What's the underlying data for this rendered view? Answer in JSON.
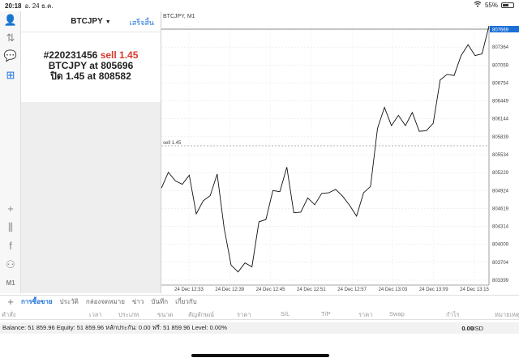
{
  "status": {
    "time": "20:18",
    "date": "อ. 24 ธ.ค.",
    "battery": "55%",
    "battery_level": 0.55
  },
  "toolbar": {
    "top": [
      {
        "name": "account-icon",
        "glyph": "👤"
      },
      {
        "name": "trade-icon",
        "glyph": "⇅"
      },
      {
        "name": "chat-icon",
        "glyph": "💬"
      },
      {
        "name": "new-order-icon",
        "glyph": "⊞"
      }
    ],
    "bottom": [
      {
        "name": "crosshair-icon",
        "glyph": "+"
      },
      {
        "name": "chart-type-icon",
        "glyph": "⫼"
      },
      {
        "name": "indicator-icon",
        "glyph": "f"
      },
      {
        "name": "objects-icon",
        "glyph": "⚇"
      },
      {
        "name": "timeframe-icon",
        "glyph": "M1"
      }
    ]
  },
  "order_panel": {
    "symbol": "BTCJPY",
    "caret": "▼",
    "done_label": "เสร็จสิ้น",
    "ticket": "#220231456",
    "side": "sell 1.45",
    "line2": "BTCJPY at 805696",
    "line3_prefix": "ปิด 1.45 at",
    "close_price": "808582"
  },
  "chart_data": {
    "type": "line",
    "title": "BTCJPY, M1",
    "price_labels": [
      "807669",
      "807364",
      "807059",
      "806754",
      "806449",
      "806144",
      "805839",
      "805534",
      "805229",
      "804924",
      "804619",
      "804314",
      "804009",
      "803704",
      "803399"
    ],
    "current_price_label": "807669",
    "time_labels": [
      "24 Dec 12:33",
      "24 Dec 12:39",
      "24 Dec 12:45",
      "24 Dec 12:51",
      "24 Dec 12:57",
      "24 Dec 13:03",
      "24 Dec 13:09",
      "24 Dec 13:15"
    ],
    "order_line": {
      "label": "sell 1.45",
      "price": 805696
    },
    "ylim": [
      803250,
      807800
    ],
    "y": [
      804950,
      805230,
      805080,
      805020,
      805180,
      804500,
      804730,
      804820,
      805200,
      804250,
      803600,
      803480,
      803640,
      803570,
      804360,
      804400,
      804910,
      804890,
      805320,
      804520,
      804530,
      804780,
      804660,
      804860,
      804870,
      804930,
      804810,
      804650,
      804460,
      804870,
      804980,
      806000,
      806370,
      806050,
      806230,
      806050,
      806280,
      805950,
      805960,
      806090,
      806850,
      806950,
      806930,
      807280,
      807470,
      807280,
      807310,
      807900
    ]
  },
  "bottom_tabs": [
    "การซื้อขาย",
    "ประวัติ",
    "กล่องจดหมาย",
    "ข่าว",
    "บันทึก",
    "เกี่ยวกับ"
  ],
  "columns": [
    "คำสั่ง",
    "เวลา",
    "ประเภท",
    "ขนาด",
    "สัญลักษณ์",
    "ราคา",
    "S/L",
    "T/P",
    "ราคา",
    "Swap",
    "กำไร",
    "หมายเหตุ"
  ],
  "balance": {
    "summary": "Balance: 51 859.96 Equity: 51 859.96 หลักประกัน: 0.00 ฟรี: 51 859.96 Level: 0.00%",
    "profit": "0.00",
    "currency": "USD"
  }
}
